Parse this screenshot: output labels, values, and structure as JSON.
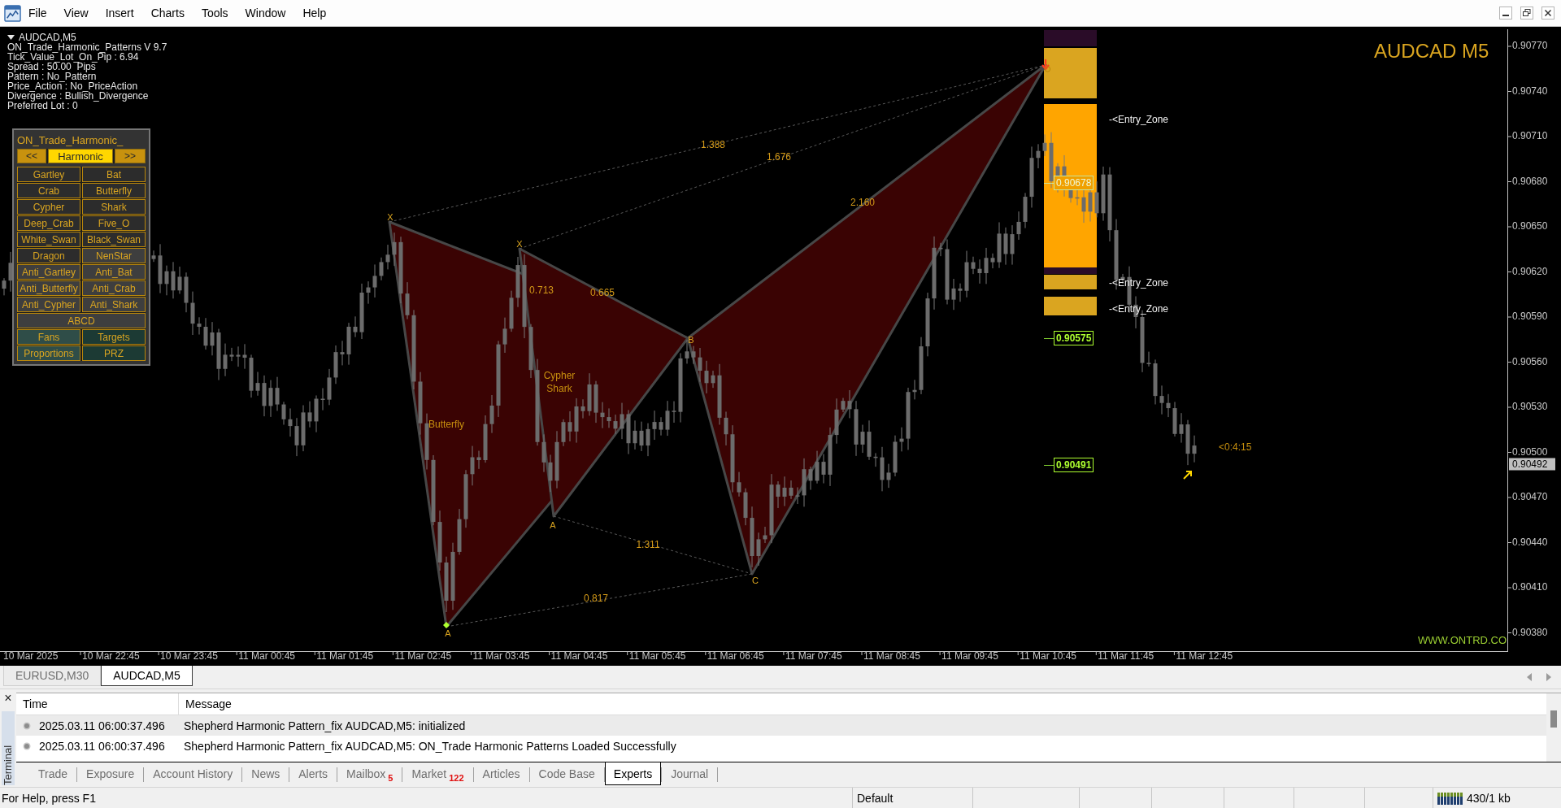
{
  "menu_bar": {
    "items": [
      "File",
      "View",
      "Insert",
      "Charts",
      "Tools",
      "Window",
      "Help"
    ]
  },
  "chart": {
    "symbol_header": "AUDCAD,M5",
    "info_lines": [
      "ON_Trade_Harmonic_Patterns V 9.7",
      "Tick_Value_Lot_On_Pip : 6.94",
      "Spread : 50.00  Pips",
      "Pattern : No_Pattern",
      "Price_Action : No_PriceAction",
      "Divergence : Bullish_Divergence",
      "Preferred Lot : 0"
    ],
    "panel": {
      "title": "ON_Trade_Harmonic_",
      "nav": {
        "prev": "<<",
        "mode": "Harmonic",
        "next": ">>"
      },
      "rows": [
        [
          {
            "label": "Gartley",
            "kind": "basic"
          },
          {
            "label": "Bat",
            "kind": "basic"
          }
        ],
        [
          {
            "label": "Crab",
            "kind": "basic"
          },
          {
            "label": "Butterfly",
            "kind": "basic"
          }
        ],
        [
          {
            "label": "Cypher",
            "kind": "basic"
          },
          {
            "label": "Shark",
            "kind": "basic"
          }
        ],
        [
          {
            "label": "Deep_Crab",
            "kind": "basic"
          },
          {
            "label": "Five_O",
            "kind": "basic"
          }
        ],
        [
          {
            "label": "White_Swan",
            "kind": "basic"
          },
          {
            "label": "Black_Swan",
            "kind": "basic"
          }
        ],
        [
          {
            "label": "Dragon",
            "kind": "basic"
          },
          {
            "label": "NenStar",
            "kind": "extended"
          }
        ],
        [
          {
            "label": "Anti_Gartley",
            "kind": "extended"
          },
          {
            "label": "Anti_Bat",
            "kind": "extended"
          }
        ],
        [
          {
            "label": "Anti_Butterfly",
            "kind": "extended"
          },
          {
            "label": "Anti_Crab",
            "kind": "extended"
          }
        ],
        [
          {
            "label": "Anti_Cypher",
            "kind": "extended"
          },
          {
            "label": "Anti_Shark",
            "kind": "extended"
          }
        ],
        [
          {
            "label": "ABCD",
            "kind": "extended"
          }
        ],
        [
          {
            "label": "Fans",
            "kind": "tool"
          },
          {
            "label": "Targets",
            "kind": "overlay"
          }
        ],
        [
          {
            "label": "Proportions",
            "kind": "tool"
          },
          {
            "label": "PRZ",
            "kind": "overlay"
          }
        ]
      ]
    },
    "symbol_title": "AUDCAD M5",
    "pattern_names": [
      "Butterfly",
      "Cypher",
      "Shark"
    ],
    "point_labels": [
      "X",
      "X",
      "A",
      "A",
      "B",
      "C"
    ],
    "ratios": [
      "1.388",
      "1.676",
      "2.160",
      "0.713",
      "0.665",
      "1.311",
      "0.817"
    ],
    "zone_labels": [
      "-<Entry_Zone",
      "-<Entry_Zone",
      "-<Entry_Zone"
    ],
    "price_tags": [
      {
        "text": "0.90678",
        "faded": true
      },
      {
        "text": "0.90575",
        "faded": false
      },
      {
        "text": "0.90491",
        "faded": false
      }
    ],
    "countdown": "<0:4:15",
    "website": "WWW.ONTRD.CO",
    "price_axis": {
      "labels": [
        "0.90770",
        "0.90740",
        "0.90710",
        "0.90680",
        "0.90650",
        "0.90620",
        "0.90590",
        "0.90560",
        "0.90530",
        "0.90500",
        "0.90470",
        "0.90440",
        "0.90410",
        "0.90380"
      ],
      "current_price": "0.90492"
    },
    "time_axis": {
      "labels": [
        "10 Mar 2025",
        "10 Mar 22:45",
        "10 Mar 23:45",
        "11 Mar 00:45",
        "11 Mar 01:45",
        "11 Mar 02:45",
        "11 Mar 03:45",
        "11 Mar 04:45",
        "11 Mar 05:45",
        "11 Mar 06:45",
        "11 Mar 07:45",
        "11 Mar 08:45",
        "11 Mar 09:45",
        "11 Mar 10:45",
        "11 Mar 11:45",
        "11 Mar 12:45"
      ]
    }
  },
  "chart_tabs": [
    {
      "label": "EURUSD,M30",
      "selected": false
    },
    {
      "label": "AUDCAD,M5",
      "selected": true
    }
  ],
  "terminal": {
    "close": "×",
    "title": "Terminal",
    "columns": [
      "Time",
      "Message"
    ],
    "rows": [
      {
        "time": "2025.03.11 06:00:37.496",
        "message": "Shepherd Harmonic Pattern_fix AUDCAD,M5: initialized"
      },
      {
        "time": "2025.03.11 06:00:37.496",
        "message": "Shepherd Harmonic Pattern_fix AUDCAD,M5: ON_Trade Harmonic Patterns Loaded Successfully"
      }
    ],
    "tabs": [
      {
        "label": "Trade",
        "selected": false
      },
      {
        "label": "Exposure",
        "selected": false
      },
      {
        "label": "Account History",
        "selected": false
      },
      {
        "label": "News",
        "selected": false
      },
      {
        "label": "Alerts",
        "selected": false
      },
      {
        "label": "Mailbox",
        "count": "5",
        "selected": false
      },
      {
        "label": "Market",
        "count": "122",
        "selected": false
      },
      {
        "label": "Articles",
        "selected": false
      },
      {
        "label": "Code Base",
        "selected": false
      },
      {
        "label": "Experts",
        "selected": true
      },
      {
        "label": "Journal",
        "selected": false
      }
    ]
  },
  "status_bar": {
    "help": "For Help, press F1",
    "profile": "Default",
    "traffic": "430/1 kb"
  }
}
